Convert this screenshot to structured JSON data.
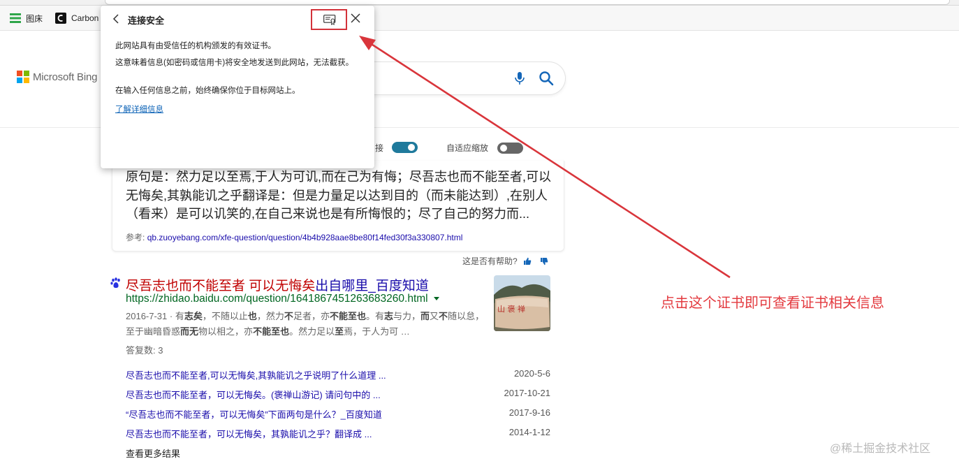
{
  "bookmarks": [
    {
      "label": "图床"
    },
    {
      "label": "Carbon"
    }
  ],
  "bing": {
    "logo_text": "Microsoft Bing"
  },
  "settings": {
    "toggle1_label": "接",
    "toggle1_on": true,
    "toggle2_label": "自适应缩放",
    "toggle2_on": false,
    "toggle_on_color": "#1f7a9c",
    "toggle_off_color": "#666666"
  },
  "answer": {
    "text": "原句是：然力足以至焉,于人为可讥,而在己为有悔；尽吾志也而不能至者,可以无悔矣,其孰能讥之乎翻译是：但是力量足以达到目的（而未能达到）,在别人（看来）是可以讥笑的,在自己来说也是有所悔恨的；尽了自己的努力而...",
    "ref_label": "参考:",
    "ref_url": "qb.zuoyebang.com/xfe-question/question/4b4b928aae8be80f14fed30f3a330807.html",
    "helpful_text": "这是否有帮助?"
  },
  "result": {
    "title_highlight": "尽吾志也而不能至者 可以无悔矣",
    "title_rest": "出自哪里_百度知道",
    "url": "https://zhidao.baidu.com/question/1641867451263683260.html",
    "snippet_date": "2016-7-31",
    "snippet_sep": " · ",
    "snippet_parts": [
      {
        "t": "有",
        "b": false
      },
      {
        "t": "志矣",
        "b": true
      },
      {
        "t": "，不随以止",
        "b": false
      },
      {
        "t": "也",
        "b": true
      },
      {
        "t": "，然力",
        "b": false
      },
      {
        "t": "不",
        "b": true
      },
      {
        "t": "足者，亦",
        "b": false
      },
      {
        "t": "不能至也",
        "b": true
      },
      {
        "t": "。有",
        "b": false
      },
      {
        "t": "志",
        "b": true
      },
      {
        "t": "与力，",
        "b": false
      },
      {
        "t": "而",
        "b": true
      },
      {
        "t": "又",
        "b": false
      },
      {
        "t": "不",
        "b": true
      },
      {
        "t": "随以怠，至于幽暗昏惑",
        "b": false
      },
      {
        "t": "而",
        "b": true
      },
      {
        "t": "无",
        "b": true
      },
      {
        "t": "物以相之，亦",
        "b": false
      },
      {
        "t": "不能至也",
        "b": true
      },
      {
        "t": "。然力足以",
        "b": false
      },
      {
        "t": "至",
        "b": true
      },
      {
        "t": "焉，于人为可 …",
        "b": false
      }
    ],
    "answer_count": "答复数: 3",
    "thumb_text": "山 褒 禅"
  },
  "sub_results": [
    {
      "title": "尽吾志也而不能至者,可以无悔矣,其孰能讥之乎说明了什么道理 ...",
      "date": "2020-5-6"
    },
    {
      "title": "尽吾志也而不能至者，可以无悔矣。(褒禅山游记) 请问句中的 ...",
      "date": "2017-10-21"
    },
    {
      "title": "“尽吾志也而不能至者，可以无悔矣”下面两句是什么？_百度知道",
      "date": "2017-9-16"
    },
    {
      "title": "尽吾志也而不能至者，可以无悔矣，其孰能讥之乎？翻译成 ...",
      "date": "2014-1-12"
    }
  ],
  "more_results": "查看更多结果",
  "popup": {
    "title": "连接安全",
    "line1": "此网站具有由受信任的机构颁发的有效证书。",
    "line2": "这意味着信息(如密码或信用卡)将安全地发送到此网站，无法截获。",
    "line3": "在输入任何信息之前，始终确保你位于目标网站上。",
    "link": "了解详细信息"
  },
  "annotation": {
    "text": "点击这个证书即可查看证书相关信息",
    "color": "#e33a3f"
  },
  "watermark": "@稀土掘金技术社区"
}
